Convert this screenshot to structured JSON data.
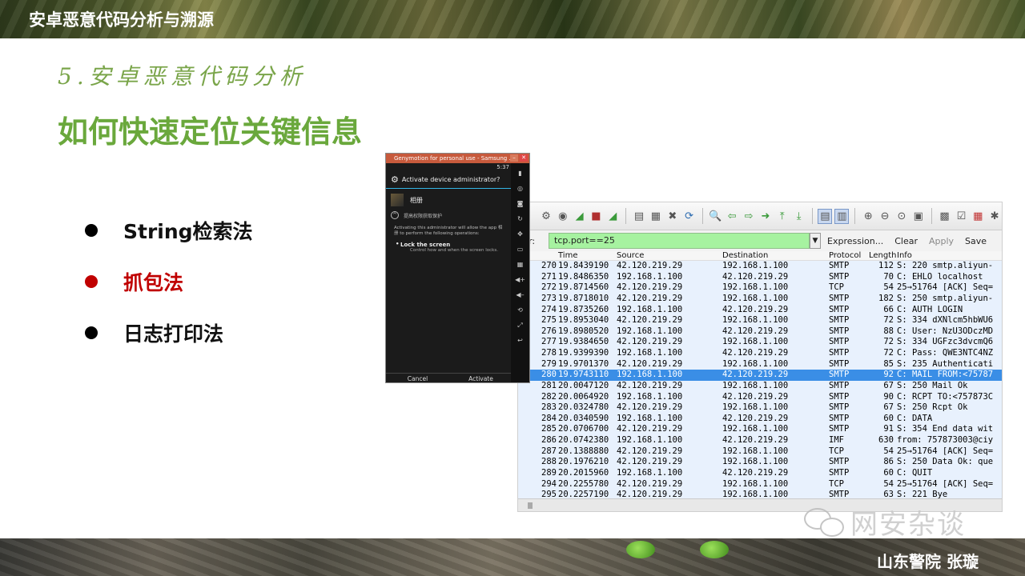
{
  "header": {
    "title": "安卓恶意代码分析与溯源"
  },
  "section": {
    "subtitle": "5.安卓恶意代码分析",
    "heading": "如何快速定位关键信息"
  },
  "bullets": [
    {
      "label": "String检索法",
      "active": false
    },
    {
      "label": "抓包法",
      "active": true
    },
    {
      "label": "日志打印法",
      "active": false
    }
  ],
  "wireshark": {
    "filter_label": "ter:",
    "filter_value": "tcp.port==25",
    "expression_label": "Expression...",
    "clear_label": "Clear",
    "apply_label": "Apply",
    "save_label": "Save",
    "columns": [
      "Time",
      "Source",
      "Destination",
      "Protocol",
      "Length",
      "Info"
    ],
    "rows": [
      {
        "no": "270",
        "time": "19.8439190",
        "src": "42.120.219.29",
        "dst": "192.168.1.100",
        "proto": "SMTP",
        "len": "112",
        "info": "S: 220 smtp.aliyun-"
      },
      {
        "no": "271",
        "time": "19.8486350",
        "src": "192.168.1.100",
        "dst": "42.120.219.29",
        "proto": "SMTP",
        "len": "70",
        "info": "C: EHLO localhost"
      },
      {
        "no": "272",
        "time": "19.8714560",
        "src": "42.120.219.29",
        "dst": "192.168.1.100",
        "proto": "TCP",
        "len": "54",
        "info": "25→51764 [ACK] Seq="
      },
      {
        "no": "273",
        "time": "19.8718010",
        "src": "42.120.219.29",
        "dst": "192.168.1.100",
        "proto": "SMTP",
        "len": "182",
        "info": "S: 250 smtp.aliyun-"
      },
      {
        "no": "274",
        "time": "19.8735260",
        "src": "192.168.1.100",
        "dst": "42.120.219.29",
        "proto": "SMTP",
        "len": "66",
        "info": "C: AUTH LOGIN"
      },
      {
        "no": "275",
        "time": "19.8953040",
        "src": "42.120.219.29",
        "dst": "192.168.1.100",
        "proto": "SMTP",
        "len": "72",
        "info": "S: 334 dXNlcm5hbWU6"
      },
      {
        "no": "276",
        "time": "19.8980520",
        "src": "192.168.1.100",
        "dst": "42.120.219.29",
        "proto": "SMTP",
        "len": "88",
        "info": "C: User: NzU3ODczMD"
      },
      {
        "no": "277",
        "time": "19.9384650",
        "src": "42.120.219.29",
        "dst": "192.168.1.100",
        "proto": "SMTP",
        "len": "72",
        "info": "S: 334 UGFzc3dvcmQ6"
      },
      {
        "no": "278",
        "time": "19.9399390",
        "src": "192.168.1.100",
        "dst": "42.120.219.29",
        "proto": "SMTP",
        "len": "72",
        "info": "C: Pass: QWE3NTC4NZ"
      },
      {
        "no": "279",
        "time": "19.9701370",
        "src": "42.120.219.29",
        "dst": "192.168.1.100",
        "proto": "SMTP",
        "len": "85",
        "info": "S: 235 Authenticati"
      },
      {
        "no": "280",
        "time": "19.9743110",
        "src": "192.168.1.100",
        "dst": "42.120.219.29",
        "proto": "SMTP",
        "len": "92",
        "info": "C: MAIL FROM:<75787",
        "selected": true
      },
      {
        "no": "281",
        "time": "20.0047120",
        "src": "42.120.219.29",
        "dst": "192.168.1.100",
        "proto": "SMTP",
        "len": "67",
        "info": "S: 250 Mail Ok"
      },
      {
        "no": "282",
        "time": "20.0064920",
        "src": "192.168.1.100",
        "dst": "42.120.219.29",
        "proto": "SMTP",
        "len": "90",
        "info": "C: RCPT TO:<757873C"
      },
      {
        "no": "283",
        "time": "20.0324780",
        "src": "42.120.219.29",
        "dst": "192.168.1.100",
        "proto": "SMTP",
        "len": "67",
        "info": "S: 250 Rcpt Ok"
      },
      {
        "no": "284",
        "time": "20.0340590",
        "src": "192.168.1.100",
        "dst": "42.120.219.29",
        "proto": "SMTP",
        "len": "60",
        "info": "C: DATA"
      },
      {
        "no": "285",
        "time": "20.0706700",
        "src": "42.120.219.29",
        "dst": "192.168.1.100",
        "proto": "SMTP",
        "len": "91",
        "info": "S: 354 End data wit"
      },
      {
        "no": "286",
        "time": "20.0742380",
        "src": "192.168.1.100",
        "dst": "42.120.219.29",
        "proto": "IMF",
        "len": "630",
        "info": "from: 757873003@ciy"
      },
      {
        "no": "287",
        "time": "20.1388880",
        "src": "42.120.219.29",
        "dst": "192.168.1.100",
        "proto": "TCP",
        "len": "54",
        "info": "25→51764 [ACK] Seq="
      },
      {
        "no": "288",
        "time": "20.1976210",
        "src": "42.120.219.29",
        "dst": "192.168.1.100",
        "proto": "SMTP",
        "len": "86",
        "info": "S: 250 Data Ok: que"
      },
      {
        "no": "289",
        "time": "20.2015960",
        "src": "192.168.1.100",
        "dst": "42.120.219.29",
        "proto": "SMTP",
        "len": "60",
        "info": "C: QUIT"
      },
      {
        "no": "294",
        "time": "20.2255780",
        "src": "42.120.219.29",
        "dst": "192.168.1.100",
        "proto": "TCP",
        "len": "54",
        "info": "25→51764 [ACK] Seq="
      },
      {
        "no": "295",
        "time": "20.2257190",
        "src": "42.120.219.29",
        "dst": "192.168.1.100",
        "proto": "SMTP",
        "len": "63",
        "info": "S: 221 Bye"
      }
    ],
    "toolbar_icons": [
      "capture-options-icon",
      "start-capture-icon",
      "shark-fin-icon",
      "stop-capture-icon",
      "restart-capture-icon",
      "open-file-icon",
      "save-file-icon",
      "close-file-icon",
      "reload-icon",
      "find-packet-icon",
      "go-back-icon",
      "go-forward-icon",
      "go-to-packet-icon",
      "go-first-icon",
      "go-last-icon",
      "colorize-icon",
      "auto-scroll-icon",
      "zoom-in-icon",
      "zoom-out-icon",
      "normal-size-icon",
      "resize-columns-icon",
      "capture-filters-icon",
      "display-filters-icon",
      "coloring-rules-icon",
      "preferences-icon"
    ]
  },
  "emulator": {
    "window_title": "Genymotion for personal use - Samsung ...",
    "status_time": "5:37",
    "dialog_title": "Activate device administrator?",
    "app_name": "相册",
    "permission_text": "提高权限获取保护",
    "description": "Activating this administrator will allow the app 相册 to perform the following operations:",
    "policy_title": "Lock the screen",
    "policy_desc": "Control how and when the screen locks.",
    "cancel_label": "Cancel",
    "activate_label": "Activate",
    "side_icons": [
      "battery-icon",
      "gps-icon",
      "camera-icon",
      "rotate-icon",
      "move-icon",
      "id-icon",
      "media-icon",
      "volume-up-icon",
      "volume-down-icon",
      "rotate-screen-icon",
      "scale-icon",
      "back-icon"
    ]
  },
  "watermark": {
    "text": "网安杂谈"
  },
  "footer": {
    "author": "山东警院  张璇"
  }
}
